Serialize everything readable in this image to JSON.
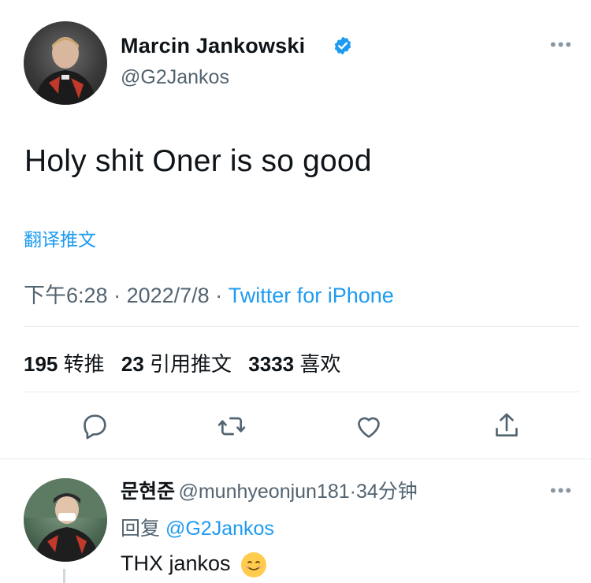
{
  "tweet": {
    "author_name": "Marcin Jankowski",
    "author_handle": "@G2Jankos",
    "text": "Holy shit Oner is so good",
    "translate_label": "翻译推文",
    "time": "下午6:28",
    "date": "2022/7/8",
    "separator": "·",
    "source": "Twitter for iPhone",
    "verified": true,
    "more_icon": "more-horizontal-icon"
  },
  "stats": [
    {
      "count": "195",
      "label": "转推"
    },
    {
      "count": "23",
      "label": "引用推文"
    },
    {
      "count": "3333",
      "label": "喜欢"
    }
  ],
  "actions": [
    {
      "name": "reply-icon"
    },
    {
      "name": "retweet-icon"
    },
    {
      "name": "like-icon"
    },
    {
      "name": "share-icon"
    }
  ],
  "reply": {
    "author_name": "문현준",
    "author_handle": "@munhyeonjun181",
    "time_ago": "34分钟",
    "reply_label": "回复",
    "reply_to": "@G2Jankos",
    "text": "THX jankos"
  },
  "colors": {
    "accent": "#1d9bf0",
    "secondary_text": "#536471",
    "divider": "#e6ecf0"
  }
}
